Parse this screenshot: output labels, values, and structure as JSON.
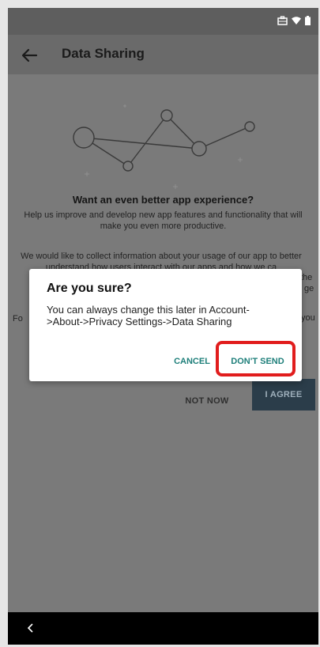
{
  "app_bar": {
    "title": "Data Sharing"
  },
  "content": {
    "heading": "Want an even better app experience?",
    "paragraph_1": "Help us improve and develop new app features and functionality that will make you even more productive.",
    "paragraph_2": "We would like to collect information about your usage of our app to better understand how users interact with our apps and how we ca",
    "paragraph_3_prefix": "Fo",
    "paragraph_2_right_fragments": [
      "the",
      "ge"
    ],
    "paragraph_3_right_fragment": "you",
    "buttons": {
      "not_now": "NOT NOW",
      "agree": "I AGREE"
    }
  },
  "dialog": {
    "title": "Are you sure?",
    "message": "You can always change this later in Account->About->Privacy Settings->Data Sharing",
    "cancel": "CANCEL",
    "dont_send": "DON'T SEND"
  },
  "colors": {
    "accent": "#1e7f7a",
    "highlight": "#e11d1d",
    "agree_button": "#2b3d4a"
  },
  "icons": [
    "briefcase-icon",
    "wifi-icon",
    "battery-icon",
    "back-arrow-icon",
    "nav-back-icon"
  ]
}
